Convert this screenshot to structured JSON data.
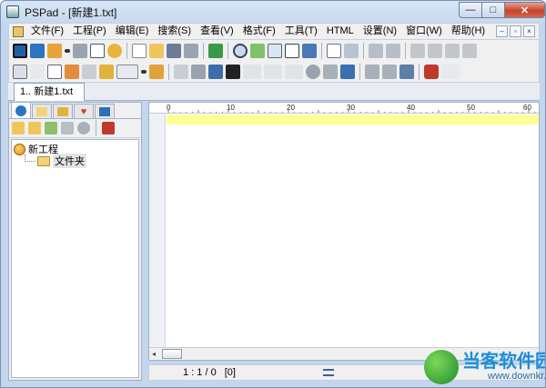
{
  "window": {
    "title": "PSPad - [新建1.txt]",
    "min": "—",
    "max": "□",
    "close": "✕"
  },
  "menu": {
    "items": [
      "文件(F)",
      "工程(P)",
      "编辑(E)",
      "搜索(S)",
      "查看(V)",
      "格式(F)",
      "工具(T)",
      "HTML",
      "设置(N)",
      "窗口(W)",
      "帮助(H)"
    ],
    "mdi_controls": [
      "–",
      "▫",
      "×"
    ]
  },
  "tabs": {
    "document": "1.. 新建1.txt"
  },
  "panel": {
    "tree": {
      "project": "新工程",
      "folder": "文件夹"
    }
  },
  "ruler": {
    "labels": [
      "0",
      "10",
      "20",
      "30",
      "40",
      "50",
      "60"
    ]
  },
  "status": {
    "position": "1 : 1 / 0",
    "selection": "[0]"
  },
  "watermark": {
    "title": "当客软件园",
    "url": "www.downkr.com"
  }
}
